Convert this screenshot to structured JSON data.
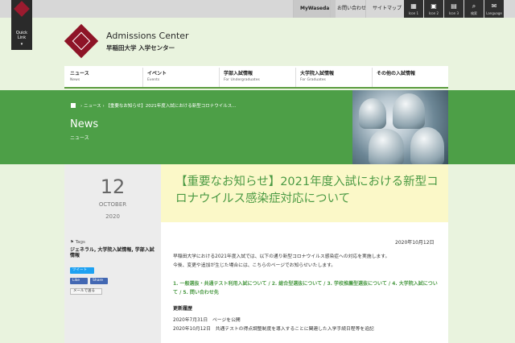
{
  "quick_link": {
    "label_line1": "Quick",
    "label_line2": "Link",
    "arrow": "▾"
  },
  "utility": {
    "mywaseda": "MyWaseda",
    "contact": "お問い合わせ",
    "sitemap": "サイトマップ",
    "icons": [
      {
        "label": "Icon 1",
        "icon": "building-icon"
      },
      {
        "label": "Icon 2",
        "icon": "bus-icon"
      },
      {
        "label": "Icon 3",
        "icon": "grid-icon"
      },
      {
        "label": "検索",
        "icon": "search-icon"
      },
      {
        "label": "Language",
        "icon": "speech-bubble-icon"
      }
    ]
  },
  "header": {
    "title_en": "Admissions Center",
    "title_jp": "早稲田大学 入学センター"
  },
  "nav": [
    {
      "jp": "ニュース",
      "en": "News"
    },
    {
      "jp": "イベント",
      "en": "Events"
    },
    {
      "jp": "学部入試情報",
      "en": "For Undergraduates"
    },
    {
      "jp": "大学院入試情報",
      "en": "For Graduates"
    },
    {
      "jp": "その他の入試情報",
      "en": ""
    }
  ],
  "breadcrumb": {
    "sep1": "›",
    "item1": "ニュース",
    "sep2": "›",
    "item2": "【重要なお知らせ】2021年度入試における新型コロナウイルス..."
  },
  "page": {
    "title": "News",
    "subtitle": "ニュース"
  },
  "date": {
    "day": "12",
    "month": "OCTOBER",
    "year": "2020"
  },
  "tags": {
    "label": "Tags",
    "value": "ジェネラル, 大学院入試情報, 学部入試情報"
  },
  "share": {
    "tweet": "ツイート",
    "like": "Like",
    "share": "Share",
    "mail": "メールで送る"
  },
  "article": {
    "heading": "【重要なお知らせ】2021年度入試における新型コロナウイルス感染症対応について",
    "date": "2020年10月12日",
    "para1": "早稲田大学における2021年度入試では、以下の通り新型コロナウイルス感染症への対応を実施します。",
    "para2": "今後、変更や追加が生じた場合には、こちらのページでお知らせいたします。",
    "links": "1. 一般選抜・共通テスト利用入試について / 2. 総合型選抜について / 3. 学校推薦型選抜について / 4. 大学院入試について / 5. 問い合わせ先",
    "history_heading": "更新履歴",
    "history1": "2020年7月31日　ページを公開",
    "history2": "2020年10月12日　共通テストの得点調整制度を導入することに関連した入学手続日程等を追記"
  },
  "colors": {
    "green": "#4d9f47",
    "crest": "#8e1427",
    "heading_bg": "#fbf8c8"
  }
}
